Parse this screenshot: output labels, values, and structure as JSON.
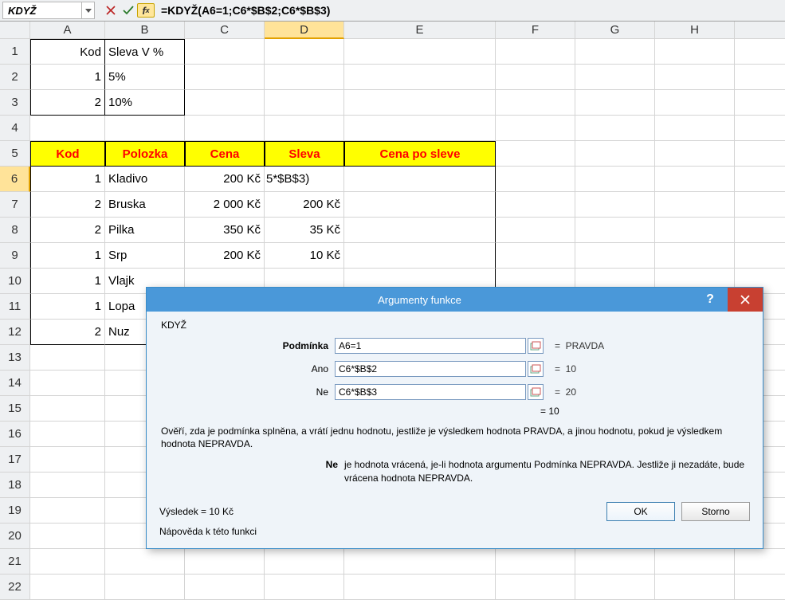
{
  "namebox": "KDYŽ",
  "formula": "=KDYŽ(A6=1;C6*$B$2;C6*$B$3)",
  "columns": [
    "A",
    "B",
    "C",
    "D",
    "E",
    "F",
    "G",
    "H"
  ],
  "row_count": 22,
  "active_col_index": 3,
  "active_row": 6,
  "sheet": {
    "A1": "Kod",
    "B1": "Sleva V %",
    "A2": "1",
    "B2": "5%",
    "A3": "2",
    "B3": "10%",
    "A5": "Kod",
    "B5": "Polozka",
    "C5": "Cena",
    "D5": "Sleva",
    "E5": "Cena po sleve",
    "A6": "1",
    "B6": "Kladivo",
    "C6": "200 Kč",
    "D6": "5*$B$3)",
    "A7": "2",
    "B7": "Bruska",
    "C7": "2 000 Kč",
    "D7": "200 Kč",
    "A8": "2",
    "B8": "Pilka",
    "C8": "350 Kč",
    "D8": "35 Kč",
    "A9": "1",
    "B9": "Srp",
    "C9": "200 Kč",
    "D9": "10 Kč",
    "A10": "1",
    "B10": "Vlajk",
    "A11": "1",
    "B11": "Lopa",
    "A12": "2",
    "B12": "Nuz"
  },
  "dialog": {
    "title": "Argumenty funkce",
    "fn": "KDYŽ",
    "args": [
      {
        "label": "Podmínka",
        "bold": true,
        "value": "A6=1",
        "result": "PRAVDA"
      },
      {
        "label": "Ano",
        "bold": false,
        "value": "C6*$B$2",
        "result": "10"
      },
      {
        "label": "Ne",
        "bold": false,
        "value": "C6*$B$3",
        "result": "20"
      }
    ],
    "overall_eq": "=   10",
    "desc1": "Ověří, zda je podmínka splněna, a vrátí jednu hodnotu, jestliže je výsledkem hodnota PRAVDA, a jinou hodnotu, pokud je výsledkem hodnota NEPRAVDA.",
    "desc2_key": "Ne",
    "desc2_val": "je hodnota vrácená, je-li hodnota argumentu Podmínka NEPRAVDA. Jestliže ji nezadáte, bude vrácena hodnota NEPRAVDA.",
    "result_label": "Výsledek =   10 Kč",
    "help_link": "Nápověda k této funkci",
    "ok": "OK",
    "cancel": "Storno"
  }
}
